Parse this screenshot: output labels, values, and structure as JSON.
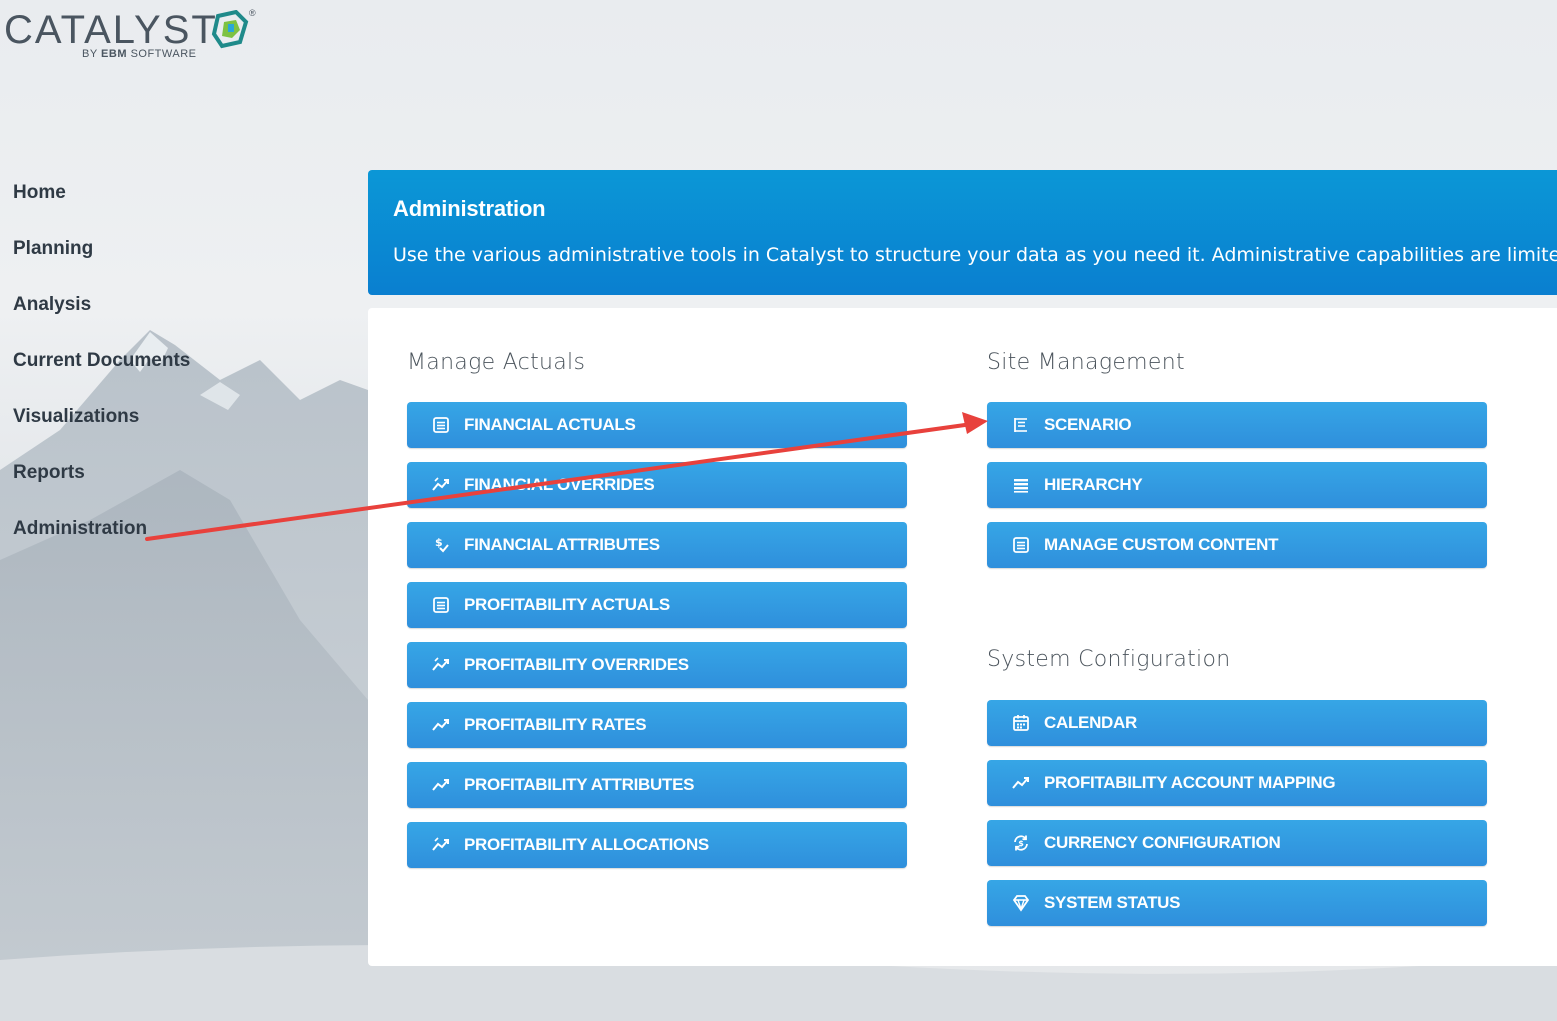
{
  "brand": {
    "name": "CATALYST",
    "byline_prefix": "BY",
    "byline_brand": "EBM",
    "byline_suffix": "SOFTWARE",
    "registered": "®"
  },
  "sidebar": {
    "items": [
      {
        "label": "Home"
      },
      {
        "label": "Planning"
      },
      {
        "label": "Analysis"
      },
      {
        "label": "Current Documents"
      },
      {
        "label": "Visualizations"
      },
      {
        "label": "Reports"
      },
      {
        "label": "Administration"
      }
    ]
  },
  "header": {
    "title": "Administration",
    "description": "Use the various administrative tools in Catalyst to structure your data as you need it. Administrative capabilities are limited fo"
  },
  "sections": {
    "manage_actuals": {
      "title": "Manage Actuals",
      "buttons": [
        {
          "label": "Financial Actuals",
          "icon": "list-icon"
        },
        {
          "label": "Financial Overrides",
          "icon": "trend-override-icon"
        },
        {
          "label": "Financial Attributes",
          "icon": "dollar-attribute-icon"
        },
        {
          "label": "Profitability Actuals",
          "icon": "list-icon"
        },
        {
          "label": "Profitability Overrides",
          "icon": "trend-override-icon"
        },
        {
          "label": "Profitability Rates",
          "icon": "trend-icon"
        },
        {
          "label": "Profitability Attributes",
          "icon": "trend-icon"
        },
        {
          "label": "Profitability Allocations",
          "icon": "trend-override-icon"
        }
      ]
    },
    "site_management": {
      "title": "Site Management",
      "buttons": [
        {
          "label": "Scenario",
          "icon": "scenario-list-icon"
        },
        {
          "label": "Hierarchy",
          "icon": "hierarchy-icon"
        },
        {
          "label": "Manage Custom Content",
          "icon": "list-icon"
        }
      ]
    },
    "system_configuration": {
      "title": "System Configuration",
      "buttons": [
        {
          "label": "Calendar",
          "icon": "calendar-icon"
        },
        {
          "label": "Profitability Account Mapping",
          "icon": "trend-icon"
        },
        {
          "label": "Currency Configuration",
          "icon": "currency-sync-icon"
        },
        {
          "label": "System Status",
          "icon": "diamond-icon"
        }
      ]
    }
  },
  "colors": {
    "banner": "#0a8ad3",
    "button": "#3299e0",
    "annotation_arrow": "#e8413c"
  }
}
